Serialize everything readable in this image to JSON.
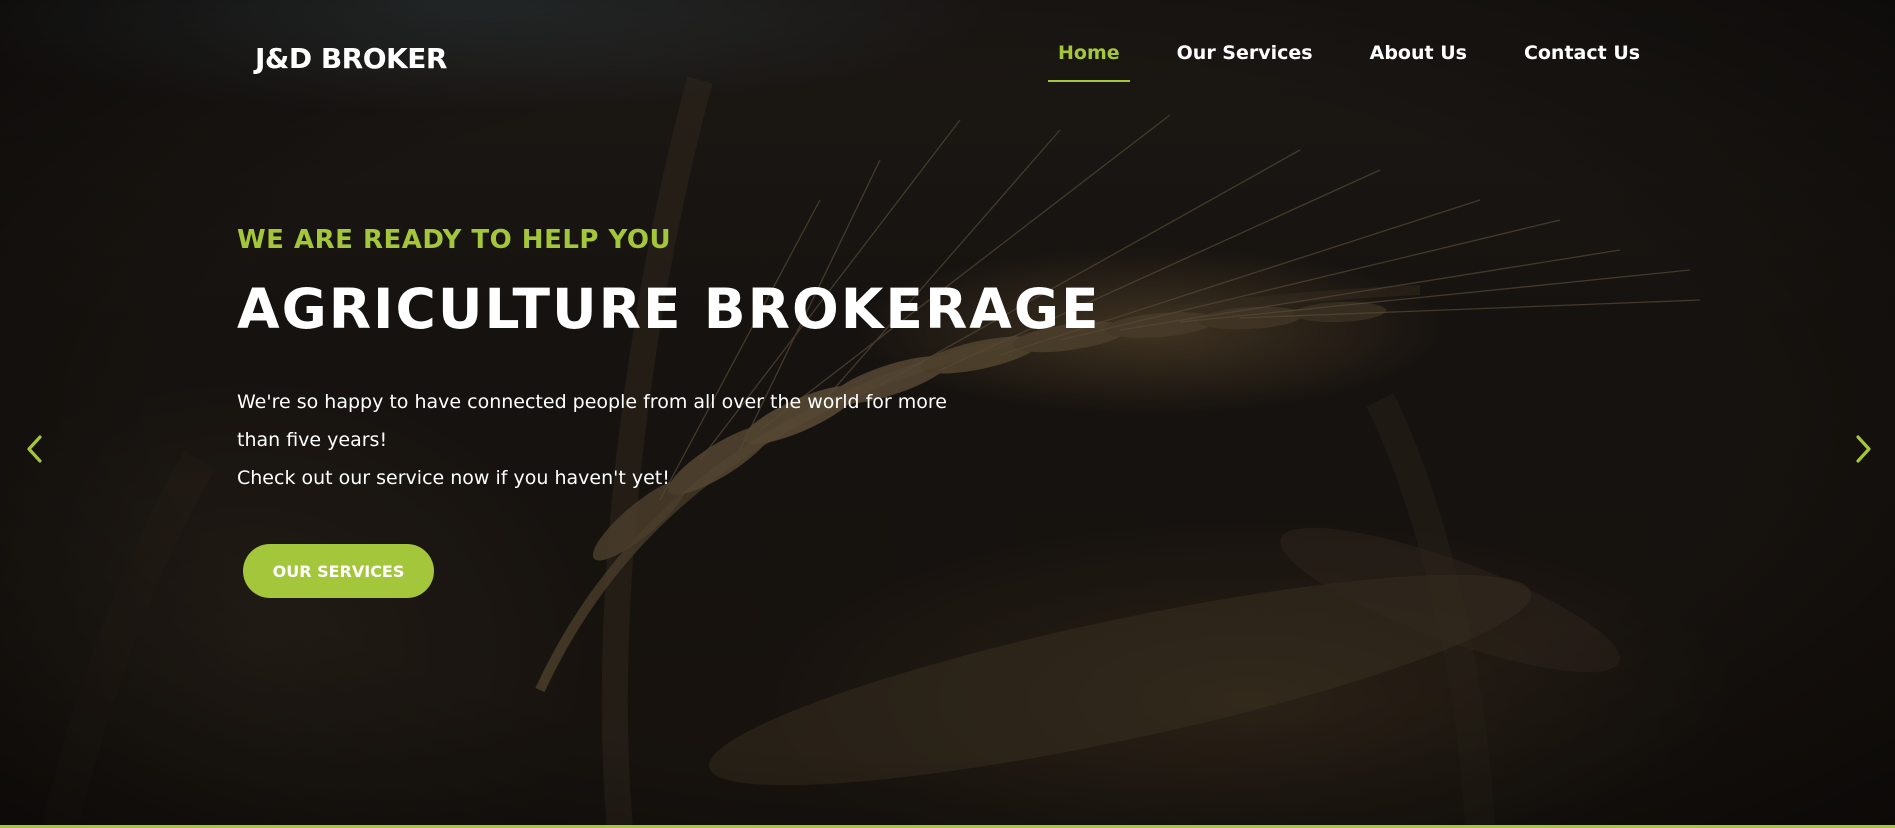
{
  "brand": {
    "logo": "J&D BROKER"
  },
  "nav": {
    "items": [
      {
        "label": "Home",
        "active": true
      },
      {
        "label": "Our Services",
        "active": false
      },
      {
        "label": "About Us",
        "active": false
      },
      {
        "label": "Contact Us",
        "active": false
      }
    ]
  },
  "hero": {
    "eyebrow": "WE ARE READY TO HELP YOU",
    "headline": "AGRICULTURE BROKERAGE",
    "description_lines": [
      "We're so happy to have connected people from all over the world for more",
      "than five years!",
      "Check out our service now if you haven't yet!"
    ],
    "cta_label": "OUR SERVICES"
  },
  "slider": {
    "prev_icon": "chevron-left-icon",
    "next_icon": "chevron-right-icon"
  },
  "colors": {
    "accent": "#a4c63a",
    "text": "#ffffff",
    "background": "#1c1713"
  }
}
